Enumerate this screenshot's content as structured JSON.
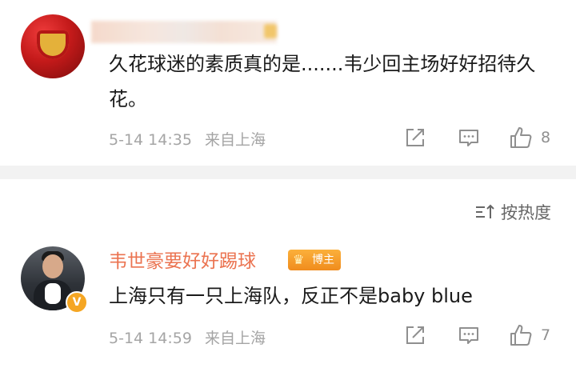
{
  "comments": [
    {
      "text": "久花球迷的素质真的是.......韦少回主场好好招待久花。",
      "time": "5-14 14:35",
      "location": "来自上海",
      "likes": "8"
    },
    {
      "username": "韦世豪要好好踢球",
      "badge": "博主",
      "text": "上海只有一只上海队，反正不是baby blue",
      "time": "5-14 14:59",
      "location": "来自上海",
      "likes": "7"
    }
  ],
  "sort_label": "按热度",
  "icons": {
    "repost": "share-out-icon",
    "reply": "comment-icon",
    "like": "thumbs-up-icon",
    "sort": "sort-icon",
    "verified": "verified-v-icon",
    "crown": "crown-icon"
  },
  "colors": {
    "username": "#eb7350",
    "badge": "#f6a032",
    "meta": "#a5a5a5",
    "divider": "#f2f2f2"
  }
}
